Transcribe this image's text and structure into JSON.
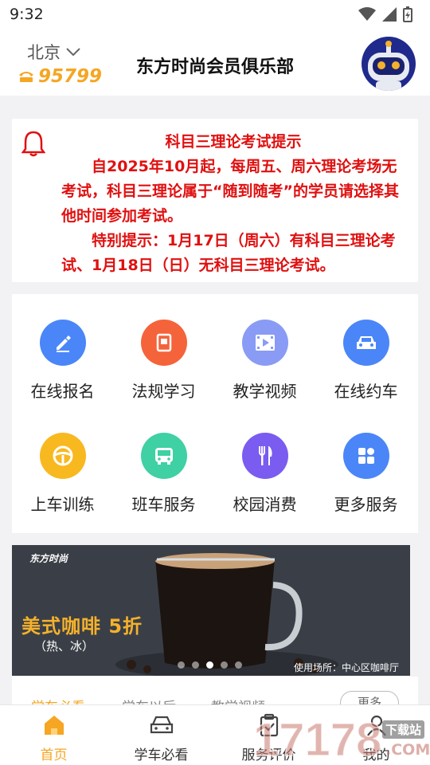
{
  "status": {
    "time": "9:32"
  },
  "header": {
    "city": "北京",
    "hotline": "95799",
    "title": "东方时尚会员俱乐部"
  },
  "notice": {
    "title": "科目三理论考试提示",
    "paragraphs": [
      "自2025年10月起，每周五、周六理论考场无考试，科目三理论属于“随到随考”的学员请选择其他时间参加考试。",
      "特别提示：1月17日（周六）有科目三理论考试、1月18日（日）无科目三理论考试。"
    ]
  },
  "services": [
    {
      "label": "在线报名",
      "icon": "pen-icon",
      "color": "#4a86f7"
    },
    {
      "label": "法规学习",
      "icon": "book-icon",
      "color": "#f5633a"
    },
    {
      "label": "教学视频",
      "icon": "film-icon",
      "color": "#8a9bf5"
    },
    {
      "label": "在线约车",
      "icon": "car-icon",
      "color": "#4a86f7"
    },
    {
      "label": "上车训练",
      "icon": "steering-wheel-icon",
      "color": "#f8b81f"
    },
    {
      "label": "班车服务",
      "icon": "bus-icon",
      "color": "#3fd0a3"
    },
    {
      "label": "校园消费",
      "icon": "fork-knife-icon",
      "color": "#7a5cf0"
    },
    {
      "label": "更多服务",
      "icon": "grid-icon",
      "color": "#4a86f7"
    }
  ],
  "banner": {
    "headline": "美式咖啡  5折",
    "sub": "（热、冰）",
    "logo": "东方时尚",
    "footer": "使用场所：中心区咖啡厅"
  },
  "tabs": [
    "学车必看",
    "学车以后",
    "教学视频"
  ],
  "more_label": "更多",
  "nav": [
    "首页",
    "学车必看",
    "服务评价",
    "我的"
  ],
  "watermark": {
    "brand": "17178",
    "sub": "下载站",
    "domain": ".COM"
  }
}
